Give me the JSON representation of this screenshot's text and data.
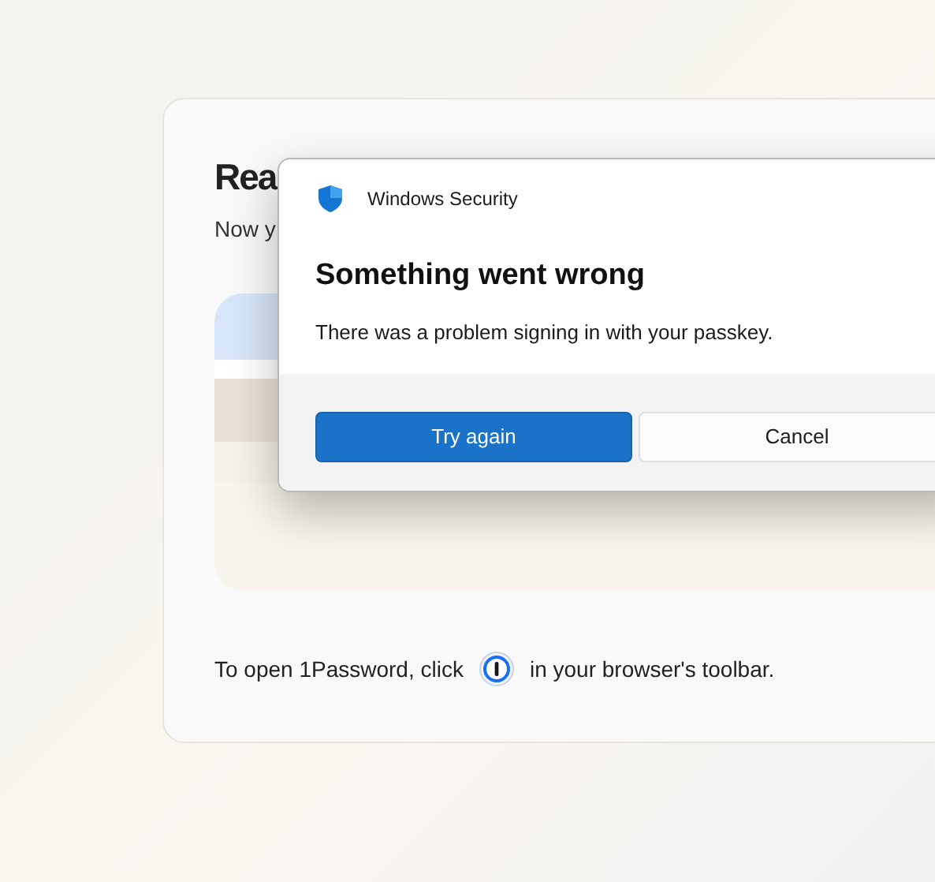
{
  "page": {
    "heading": "Rea",
    "subtitle": "Now y",
    "hint_before": "To open 1Password, click",
    "hint_after": "in your browser's toolbar."
  },
  "dialog": {
    "app": "Windows Security",
    "title": "Something went wrong",
    "message": "There was a problem signing in with your passkey.",
    "buttons": [
      {
        "label": "Try again",
        "kind": "primary"
      },
      {
        "label": "Cancel",
        "kind": "secondary"
      }
    ]
  }
}
